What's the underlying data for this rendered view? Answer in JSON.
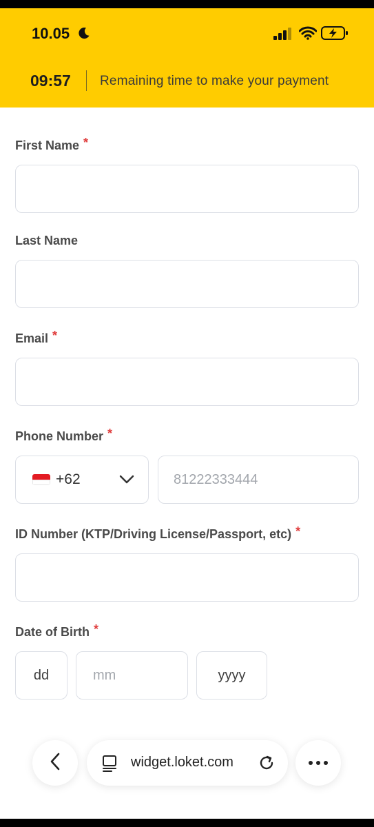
{
  "status_bar": {
    "time": "10.05"
  },
  "timer": {
    "value": "09:57",
    "text": "Remaining time to make your payment"
  },
  "form": {
    "first_name": {
      "label": "First Name",
      "required": "*",
      "value": "",
      "placeholder": ""
    },
    "last_name": {
      "label": "Last Name",
      "value": "",
      "placeholder": ""
    },
    "email": {
      "label": "Email",
      "required": "*",
      "value": "",
      "placeholder": ""
    },
    "phone": {
      "label": "Phone Number",
      "required": "*",
      "country_code": "+62",
      "placeholder": "81222333444"
    },
    "id_number": {
      "label": "ID Number (KTP/Driving License/Passport, etc)",
      "required": "*",
      "value": "",
      "placeholder": ""
    },
    "dob": {
      "label": "Date of Birth",
      "required": "*",
      "day_placeholder": "dd",
      "month_placeholder": "mm",
      "year_placeholder": "yyyy"
    }
  },
  "browser": {
    "url": "widget.loket.com"
  },
  "colors": {
    "accent": "#FFCC00",
    "required": "#E03E3E",
    "border": "#DCDFE6"
  },
  "icons": [
    "moon-icon",
    "signal-icon",
    "wifi-icon",
    "battery-charging-icon",
    "flag-indonesia-icon",
    "chevron-down-icon",
    "back-icon",
    "page-icon",
    "reload-icon",
    "more-icon"
  ]
}
